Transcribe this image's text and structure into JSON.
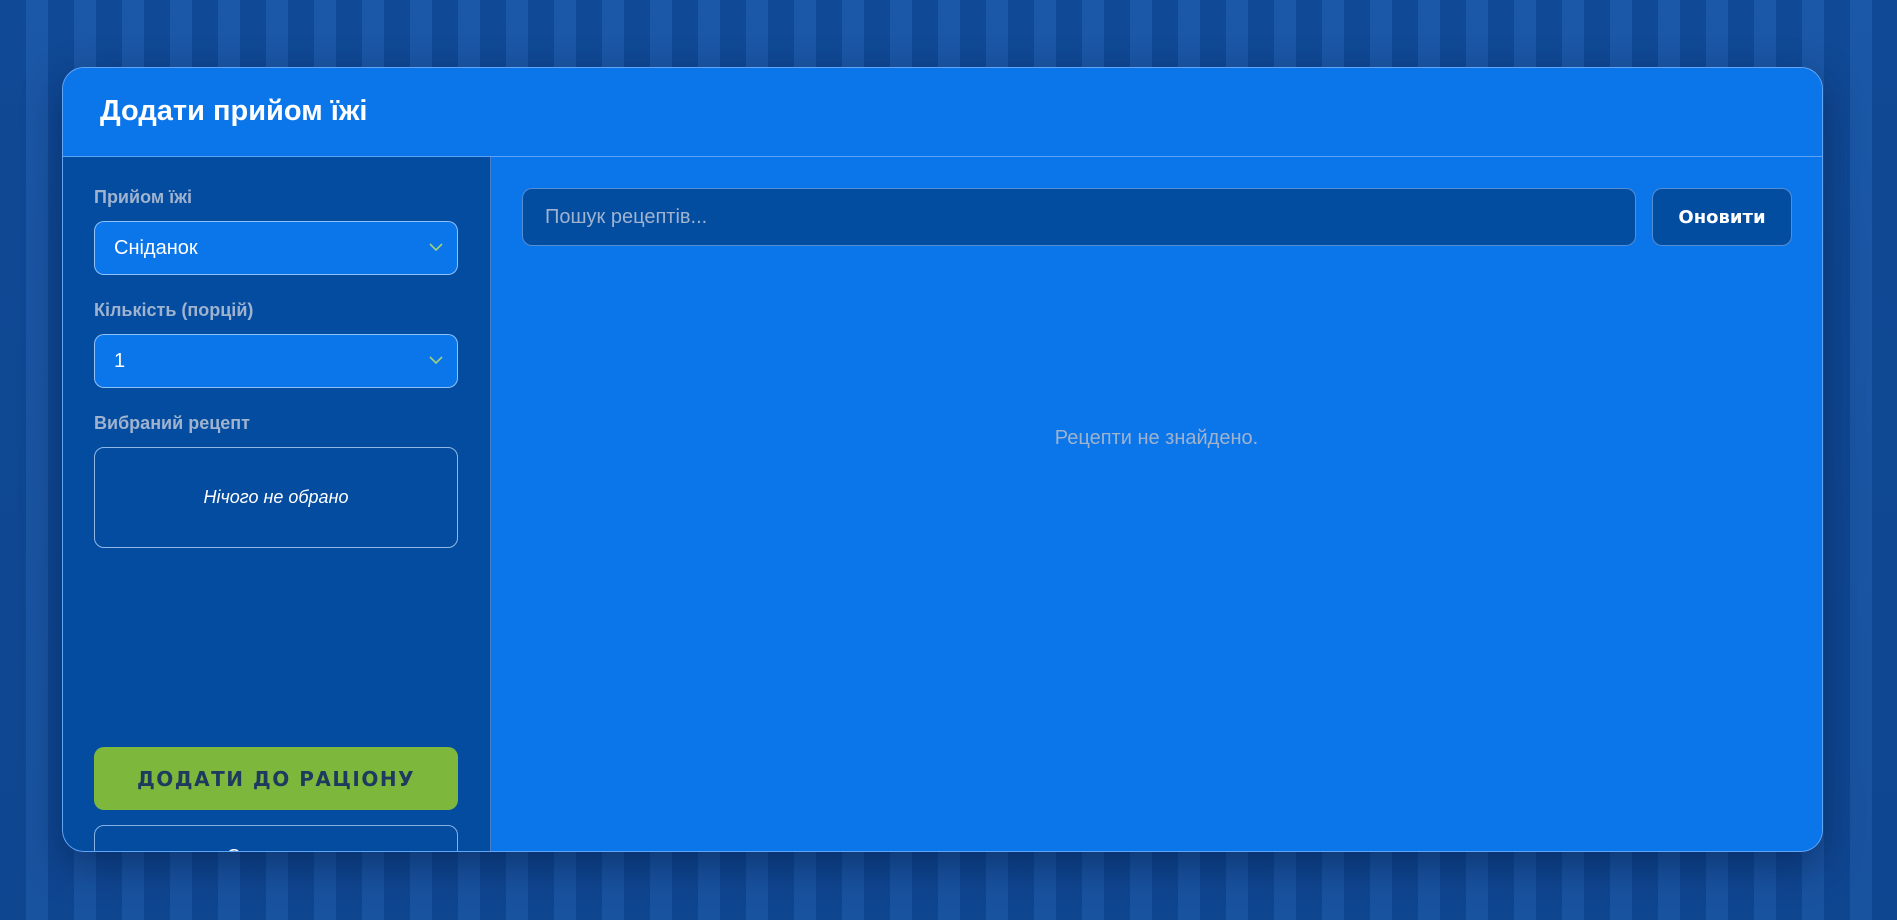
{
  "dialog": {
    "title": "Додати прийом їжі"
  },
  "form": {
    "meal_label": "Прийом їжі",
    "meal_value": "Сніданок",
    "quantity_label": "Кількість (порцій)",
    "quantity_value": "1",
    "selected_recipe_label": "Вибраний рецепт",
    "selected_recipe_empty": "Нічого не обрано",
    "add_button": "ДОДАТИ ДО РАЦІОНУ",
    "cancel_button": "Скасувати"
  },
  "recipes": {
    "search_placeholder": "Пошук рецептів...",
    "refresh_button": "Оновити",
    "empty_message": "Рецепти не знайдено."
  },
  "colors": {
    "accent": "#0b75ea",
    "panel": "#044c9f",
    "add_button": "#7db83c"
  },
  "icons": {
    "select_chevron": "chevron-down-icon"
  }
}
